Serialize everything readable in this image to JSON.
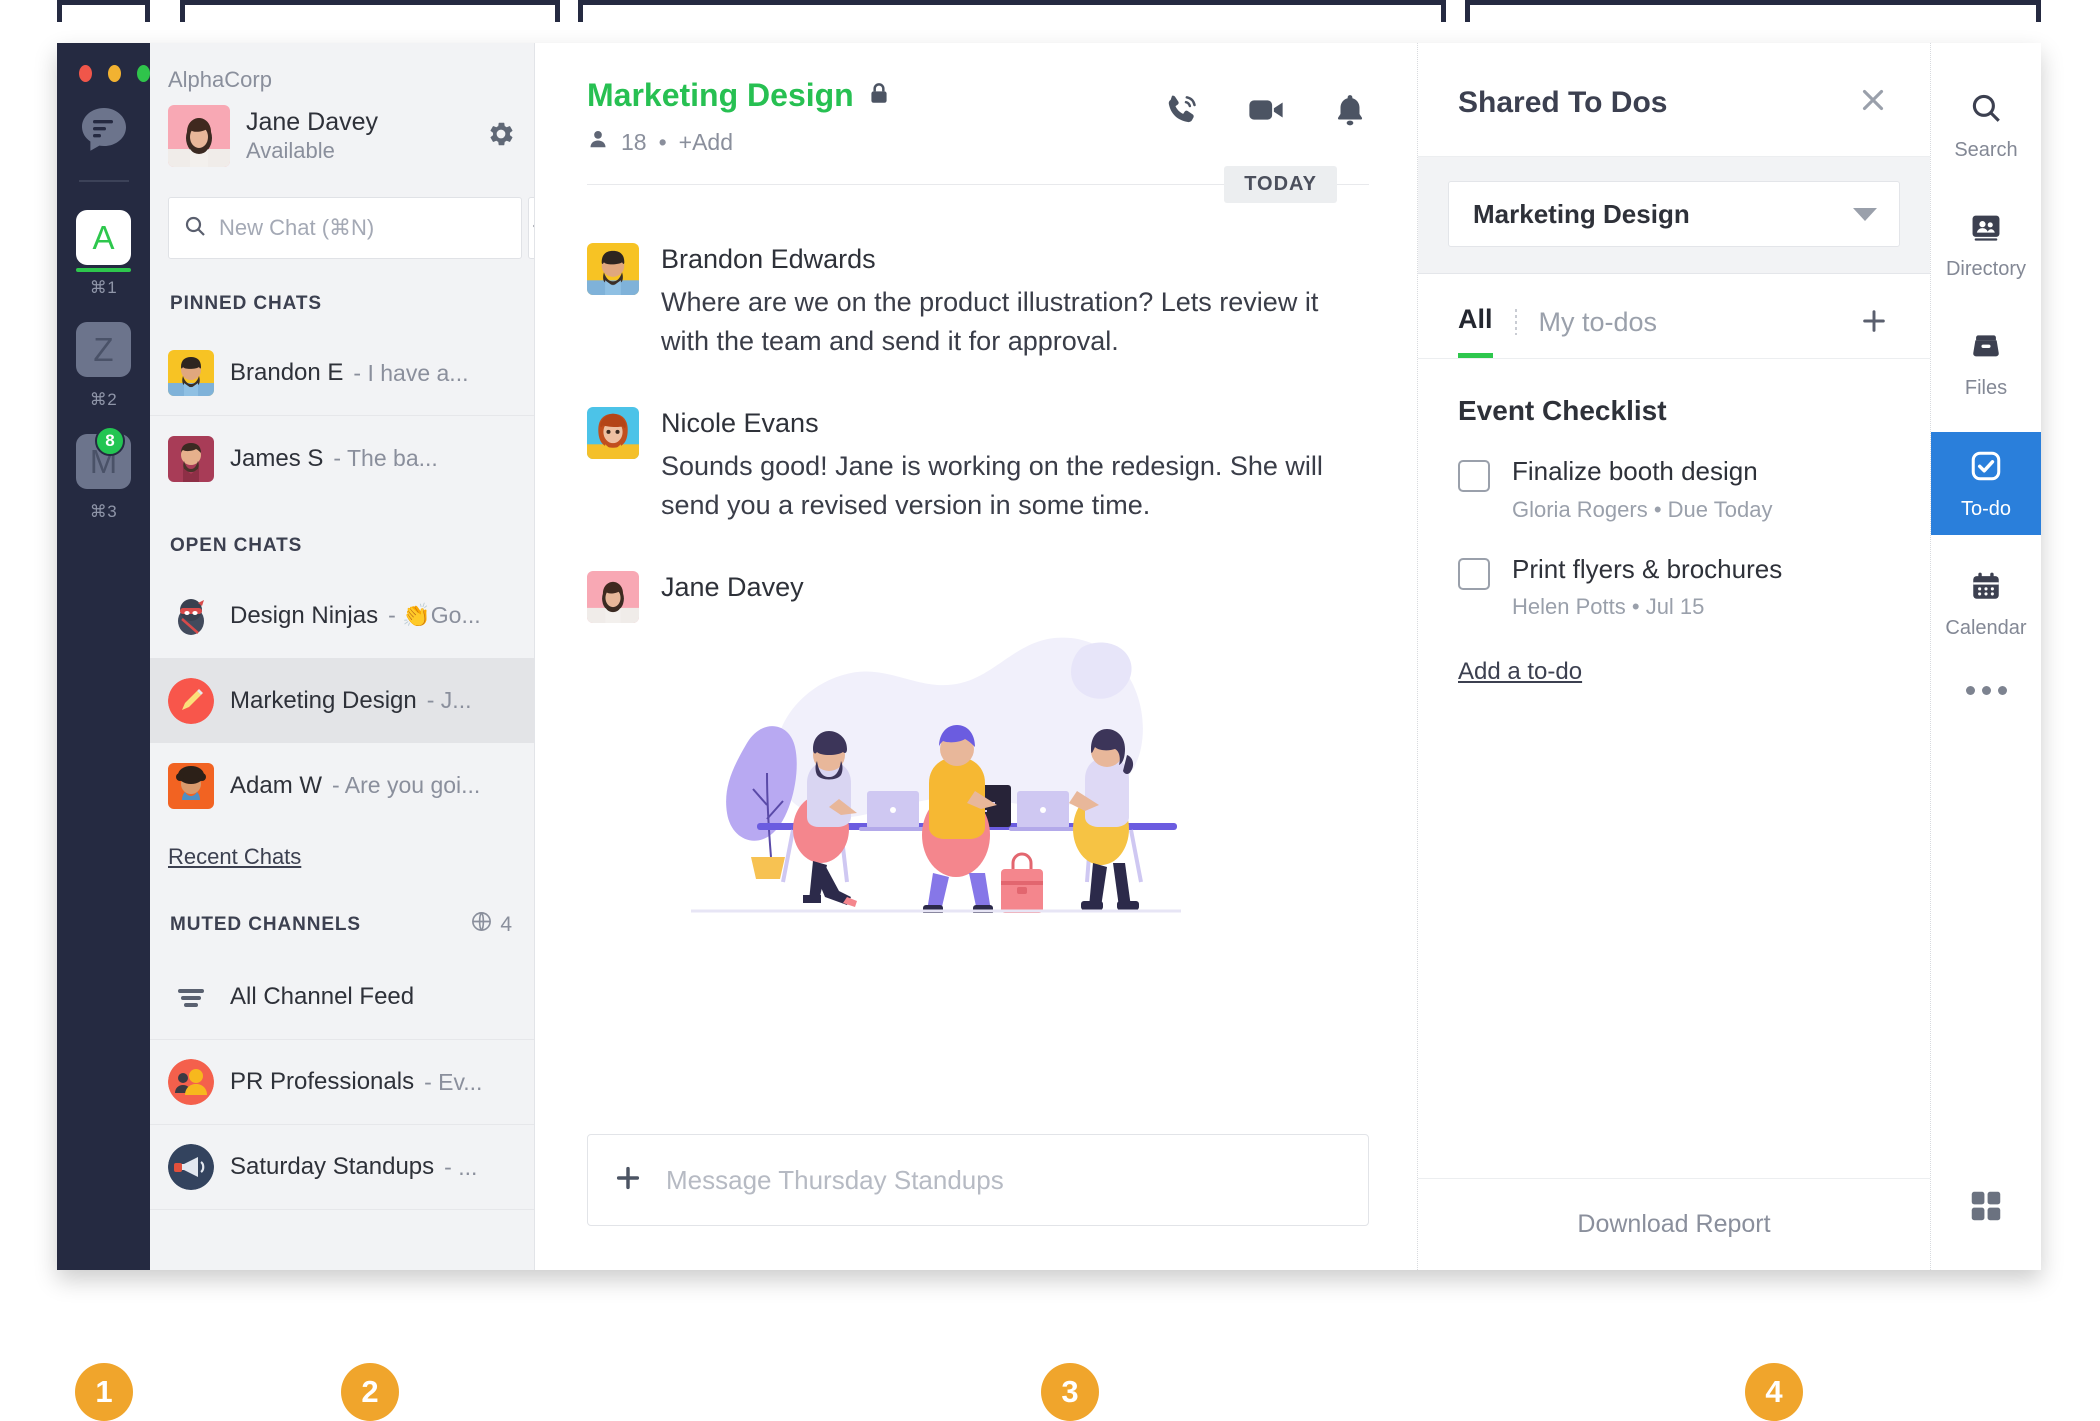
{
  "workspace_rail": {
    "app_logo_icon": "chat-bubble-logo",
    "window_controls": [
      "close-red",
      "minimize-yellow",
      "maximize-green"
    ],
    "workspaces": [
      {
        "initial": "A",
        "shortcut": "⌘1",
        "active": true,
        "badge": null
      },
      {
        "initial": "Z",
        "shortcut": "⌘2",
        "active": false,
        "badge": null
      },
      {
        "initial": "M",
        "shortcut": "⌘3",
        "active": false,
        "badge": "8"
      }
    ]
  },
  "chat_panel": {
    "org_name": "AlphaCorp",
    "me": {
      "name": "Jane Davey",
      "status": "Available",
      "avatar": "jane-avatar"
    },
    "settings_icon": "gear-icon",
    "search": {
      "placeholder": "New Chat (⌘N)",
      "value": "",
      "icon": "search-icon"
    },
    "new_chat_icon": "plus-icon",
    "sections": [
      {
        "title": "PINNED CHATS",
        "meta": null,
        "rows": [
          {
            "name": "Brandon E",
            "snippet": "- I have a...",
            "avatar_color": "#f7c324",
            "avatar": "brandon-avatar",
            "selected": false
          },
          {
            "name": "James S",
            "snippet": "- The ba...",
            "avatar_color": "#b13f5a",
            "avatar": "james-avatar",
            "selected": false
          }
        ]
      },
      {
        "title": "OPEN CHATS",
        "meta": null,
        "rows": [
          {
            "name": "Design Ninjas",
            "snippet": "- 👏Go...",
            "avatar_color": "#f2f3f5",
            "avatar": "ninja-emoji",
            "selected": false
          },
          {
            "name": "Marketing Design",
            "snippet": "- J...",
            "avatar_color": "#f8564b",
            "avatar": "pencil-emoji",
            "selected": true
          },
          {
            "name": "Adam W",
            "snippet": "- Are you goi...",
            "avatar_color": "#f26322",
            "avatar": "adam-avatar",
            "selected": false
          }
        ]
      }
    ],
    "recent_chats_link": "Recent Chats",
    "muted": {
      "title": "MUTED CHANNELS",
      "globe_icon": "globe-icon",
      "count": "4",
      "rows": [
        {
          "name": "All Channel Feed",
          "snippet": "",
          "avatar": "feed-lines-icon",
          "avatar_color": "#f2f3f5"
        },
        {
          "name": "PR Professionals",
          "snippet": "- Ev...",
          "avatar": "people-emoji",
          "avatar_color": "#f4604c"
        },
        {
          "name": "Saturday Standups",
          "snippet": "- ...",
          "avatar": "megaphone-emoji",
          "avatar_color": "#33435e"
        }
      ]
    }
  },
  "conversation": {
    "title": "Marketing Design",
    "lock_icon": "lock-icon",
    "member_icon": "person-icon",
    "member_count": "18",
    "separator_dot": "•",
    "add_label": "+Add",
    "actions": [
      {
        "icon": "phone-call-icon",
        "name": "voice-call-button"
      },
      {
        "icon": "video-camera-icon",
        "name": "video-call-button"
      },
      {
        "icon": "bell-icon",
        "name": "notifications-button"
      }
    ],
    "day_divider": "TODAY",
    "messages": [
      {
        "author": "Brandon Edwards",
        "avatar": "brandon-avatar",
        "avatar_color": "#f7c324",
        "text": "Where are we on the product illustration? Lets review it with the team and send it for approval."
      },
      {
        "author": "Nicole Evans",
        "avatar": "nicole-avatar",
        "avatar_color": "#4cc3e8",
        "text": "Sounds good! Jane is working on the redesign. She will send you a revised version in some time."
      },
      {
        "author": "Jane Davey",
        "avatar": "jane-avatar",
        "avatar_color": "#f9b8c0",
        "text": "",
        "attachment": "team-working-illustration"
      }
    ],
    "composer": {
      "placeholder": "Message Thursday Standups",
      "value": "",
      "plus_icon": "plus-icon"
    }
  },
  "todo_panel": {
    "title": "Shared To Dos",
    "close_icon": "close-icon",
    "selected_channel": "Marketing Design",
    "tabs": [
      {
        "label": "All",
        "active": true
      },
      {
        "label": "My to-dos",
        "active": false
      }
    ],
    "add_icon": "plus-icon",
    "group_title": "Event Checklist",
    "items": [
      {
        "text": "Finalize booth design",
        "assignee": "Gloria Rogers",
        "sep": "•",
        "due": "Due Today",
        "checked": false
      },
      {
        "text": "Print flyers & brochures",
        "assignee": "Helen Potts",
        "sep": "•",
        "due": "Jul 15",
        "checked": false
      }
    ],
    "add_link": "Add a to-do",
    "footer_label": "Download Report"
  },
  "icon_rail": {
    "buttons": [
      {
        "label": "Search",
        "icon": "search-icon",
        "active": false
      },
      {
        "label": "Directory",
        "icon": "directory-icon",
        "active": false
      },
      {
        "label": "Files",
        "icon": "files-icon",
        "active": false
      },
      {
        "label": "To-do",
        "icon": "checkbox-icon",
        "active": true
      },
      {
        "label": "Calendar",
        "icon": "calendar-icon",
        "active": false
      }
    ],
    "more_icon": "more-dots-icon",
    "apps_icon": "grid-apps-icon"
  },
  "annotations": {
    "accent_color": "#f0a52c",
    "callouts": [
      {
        "number": "1"
      },
      {
        "number": "2"
      },
      {
        "number": "3"
      },
      {
        "number": "4"
      }
    ]
  }
}
